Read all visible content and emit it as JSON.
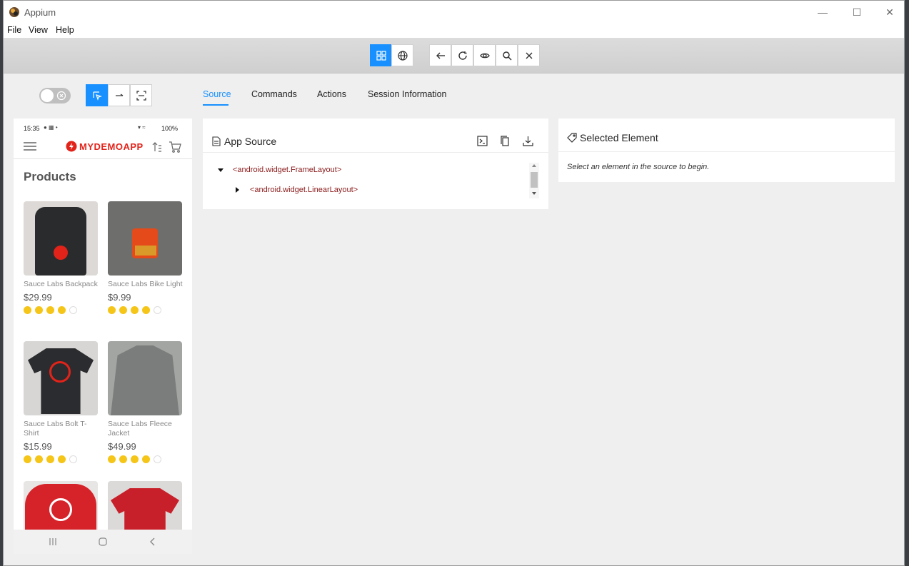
{
  "window": {
    "title": "Appium"
  },
  "menu": [
    "File",
    "View",
    "Help"
  ],
  "tabs": [
    {
      "label": "Source"
    },
    {
      "label": "Commands"
    },
    {
      "label": "Actions"
    },
    {
      "label": "Session Information"
    }
  ],
  "device": {
    "status_time": "15:35",
    "status_battery": "100%",
    "logo": "MYDEMOAPP",
    "page_title": "Products",
    "products": [
      {
        "name": "Sauce Labs Backpack",
        "price": "$29.99",
        "rating": 4
      },
      {
        "name": "Sauce Labs Bike Light",
        "price": "$9.99",
        "rating": 4
      },
      {
        "name": "Sauce Labs Bolt T-Shirt",
        "price": "$15.99",
        "rating": 4
      },
      {
        "name": "Sauce Labs Fleece Jacket",
        "price": "$49.99",
        "rating": 4
      }
    ]
  },
  "source_panel": {
    "title": "App Source",
    "tree": [
      "<android.widget.FrameLayout>",
      "<android.widget.LinearLayout>"
    ]
  },
  "selected_panel": {
    "title": "Selected Element",
    "hint": "Select an element in the source to begin."
  },
  "colors": {
    "accent": "#1890ff",
    "brand_red": "#e2231a",
    "star": "#f5c518"
  }
}
